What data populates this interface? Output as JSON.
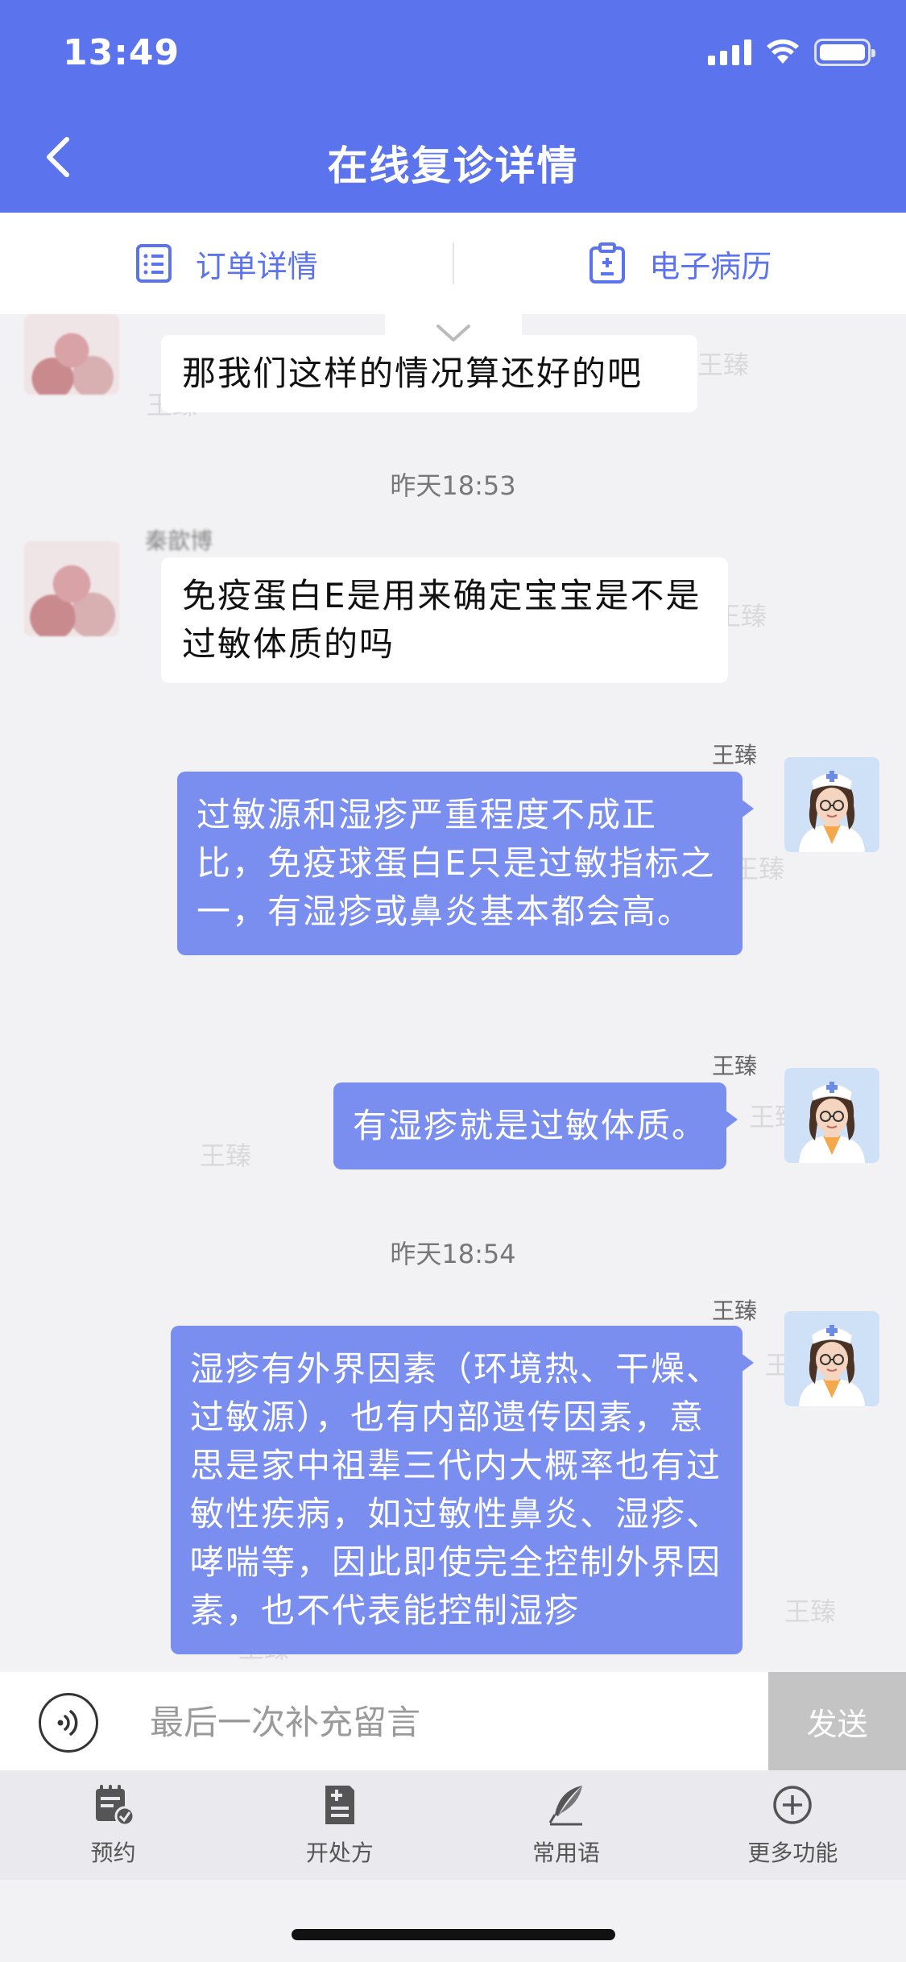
{
  "status_bar": {
    "time": "13:49"
  },
  "header": {
    "title": "在线复诊详情"
  },
  "tabs": [
    {
      "label": "订单详情",
      "icon": "list-icon"
    },
    {
      "label": "电子病历",
      "icon": "medical-record-icon"
    }
  ],
  "chat": {
    "messages": [
      {
        "side": "in",
        "text": "那我们这样的情况算还好的吧"
      },
      {
        "type": "time",
        "text": "昨天18:53"
      },
      {
        "side": "in",
        "sender": "秦歆博",
        "text": "免疫蛋白E是用来确定宝宝是不是过敏体质的吗"
      },
      {
        "side": "out",
        "sender": "王臻",
        "text": "过敏源和湿疹严重程度不成正比，免疫球蛋白E只是过敏指标之一，有湿疹或鼻炎基本都会高。"
      },
      {
        "side": "out",
        "sender": "王臻",
        "text": "有湿疹就是过敏体质。"
      },
      {
        "type": "time",
        "text": "昨天18:54"
      },
      {
        "side": "out",
        "sender": "王臻",
        "text": "湿疹有外界因素（环境热、干燥、过敏源），也有内部遗传因素，意思是家中祖辈三代内大概率也有过敏性疾病，如过敏性鼻炎、湿疹、哮喘等，因此即使完全控制外界因素，也不代表能控制湿疹"
      }
    ],
    "watermark": "王臻"
  },
  "input": {
    "placeholder": "最后一次补充留言",
    "send_label": "发送"
  },
  "toolbar": [
    {
      "label": "预约",
      "icon": "appointment-icon"
    },
    {
      "label": "开处方",
      "icon": "prescription-icon"
    },
    {
      "label": "常用语",
      "icon": "quill-icon"
    },
    {
      "label": "更多功能",
      "icon": "plus-circle-icon"
    }
  ],
  "colors": {
    "primary": "#5b73ec",
    "bubble_out": "#7a8ef0",
    "send_disabled": "#c4c4c4"
  }
}
